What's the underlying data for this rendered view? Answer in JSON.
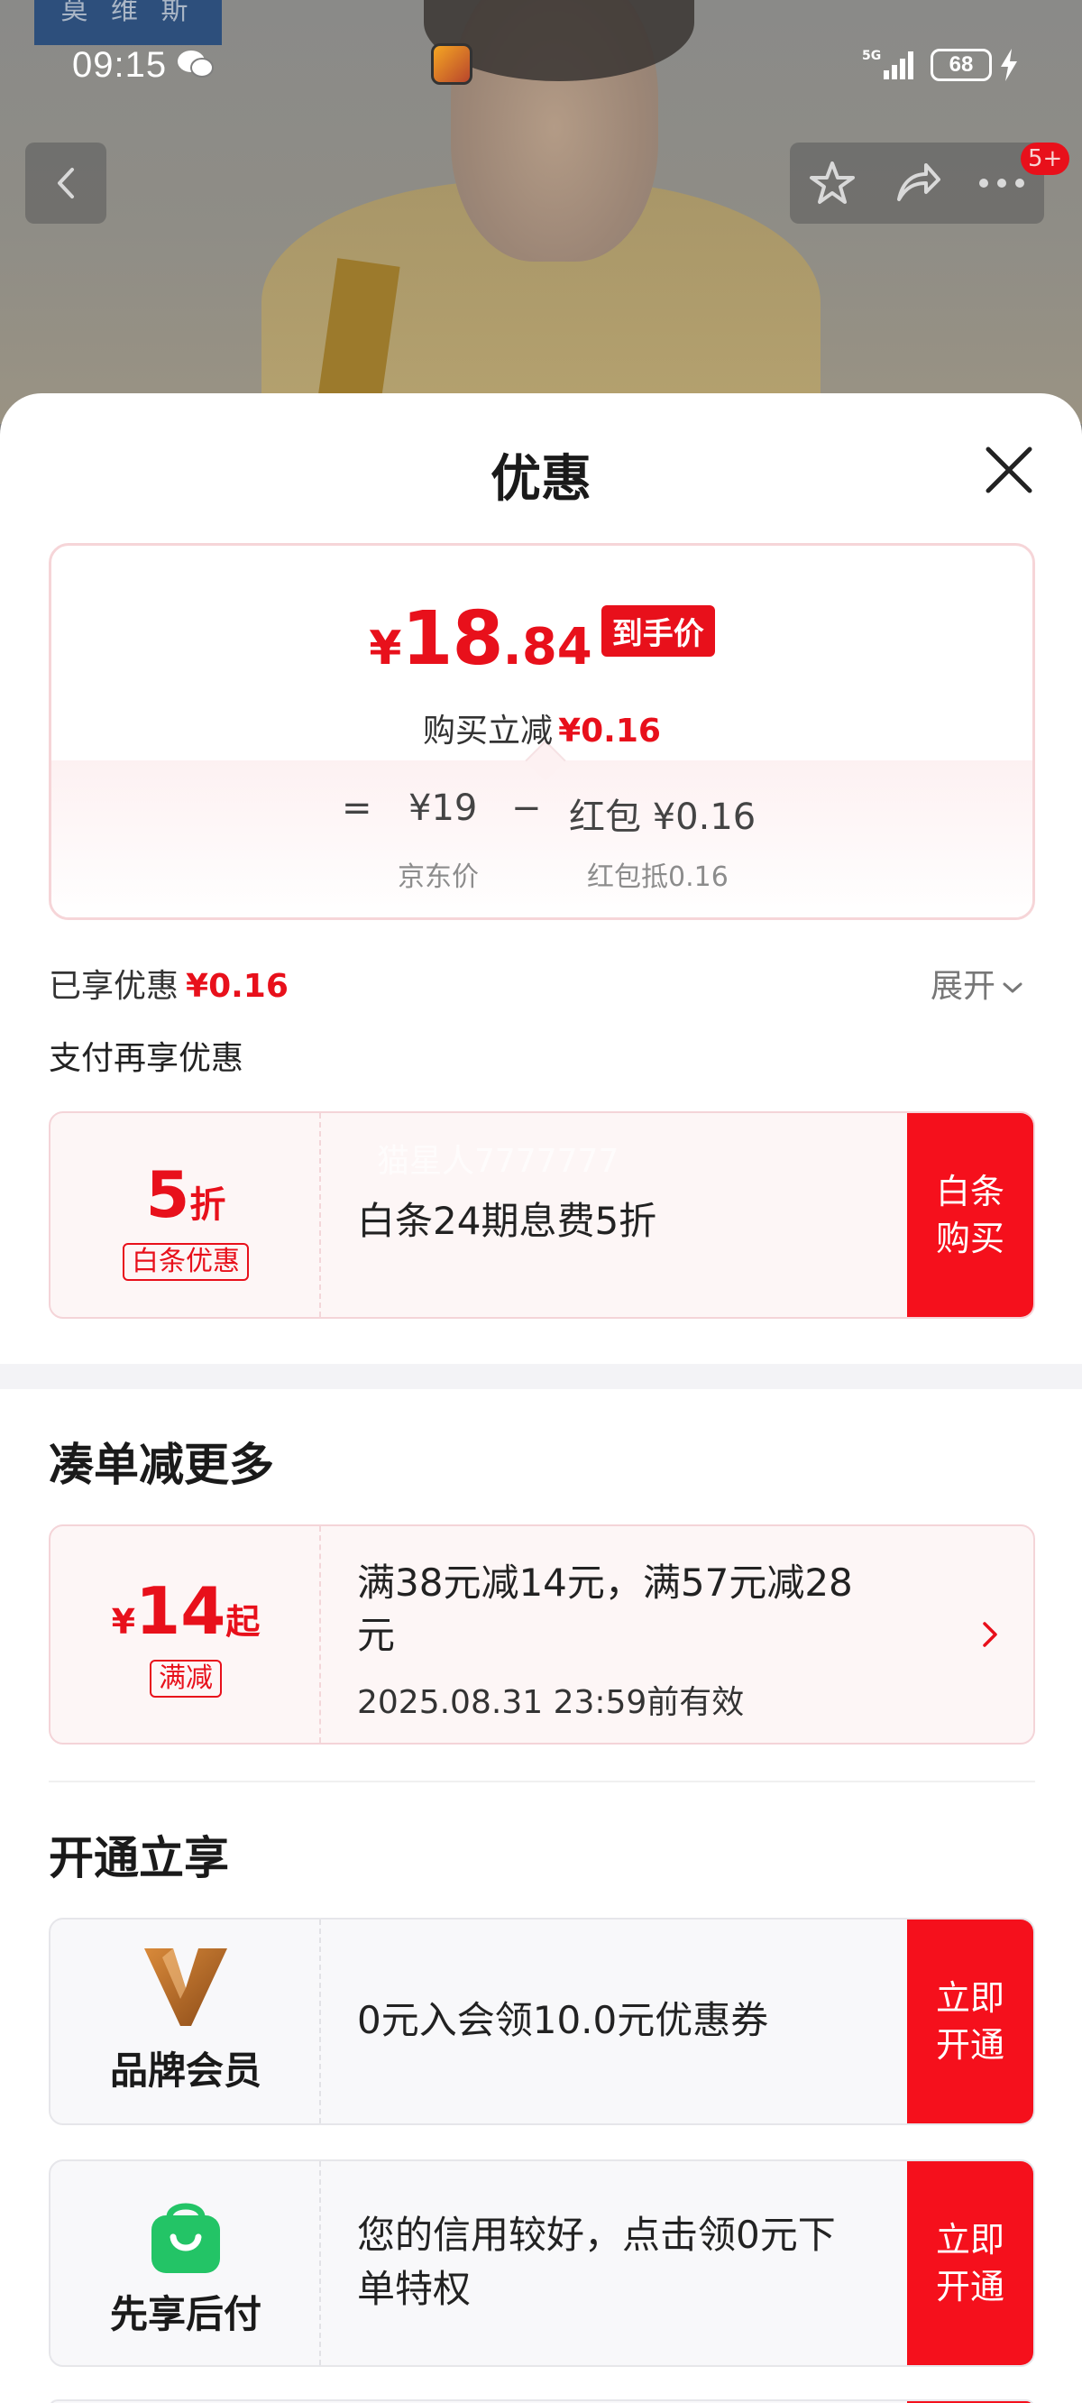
{
  "status_bar": {
    "time": "09:15",
    "network": "5G",
    "battery": "68"
  },
  "background": {
    "brand_tag": "莫 维 斯"
  },
  "nav": {
    "badge": "5+"
  },
  "sheet": {
    "title": "优惠",
    "price_card": {
      "currency": "¥",
      "price_int": "18",
      "price_dec": ".84",
      "price_tag": "到手价",
      "sub_label": "购买立减",
      "sub_value": "¥0.16",
      "eq": "=",
      "base_price": "¥19",
      "minus": "−",
      "redpack": "红包 ¥0.16",
      "base_label": "京东价",
      "redpack_label": "红包抵0.16"
    },
    "enjoyed_label": "已享优惠",
    "enjoyed_value": "¥0.16",
    "expand_label": "展开",
    "pay_title": "支付再享优惠",
    "baitiao": {
      "discount_num": "5",
      "discount_unit": "折",
      "tag": "白条优惠",
      "watermark": "猫星人7777777",
      "text": "白条24期息费5折",
      "action": "白条购买"
    },
    "section_more": "凑单减更多",
    "manjian": {
      "currency": "¥",
      "amount": "14",
      "suffix": "起",
      "tag": "满减",
      "text_line1": "满38元减14元，满57元减28",
      "text_line2": "元",
      "validity": "2025.08.31 23:59前有效"
    },
    "section_open": "开通立享",
    "brand_member": {
      "name": "品牌会员",
      "text": "0元入会领10.0元优惠券",
      "action": "立即开通"
    },
    "pay_later": {
      "name": "先享后付",
      "text_line1": "您的信用较好，点击领0元下",
      "text_line2": "单特权",
      "action": "立即开通"
    }
  },
  "colors": {
    "accent": "#e8101b",
    "action": "#f5101c",
    "coupon_bg": "#fdf6f6",
    "member_bg": "#f8f8fa"
  }
}
